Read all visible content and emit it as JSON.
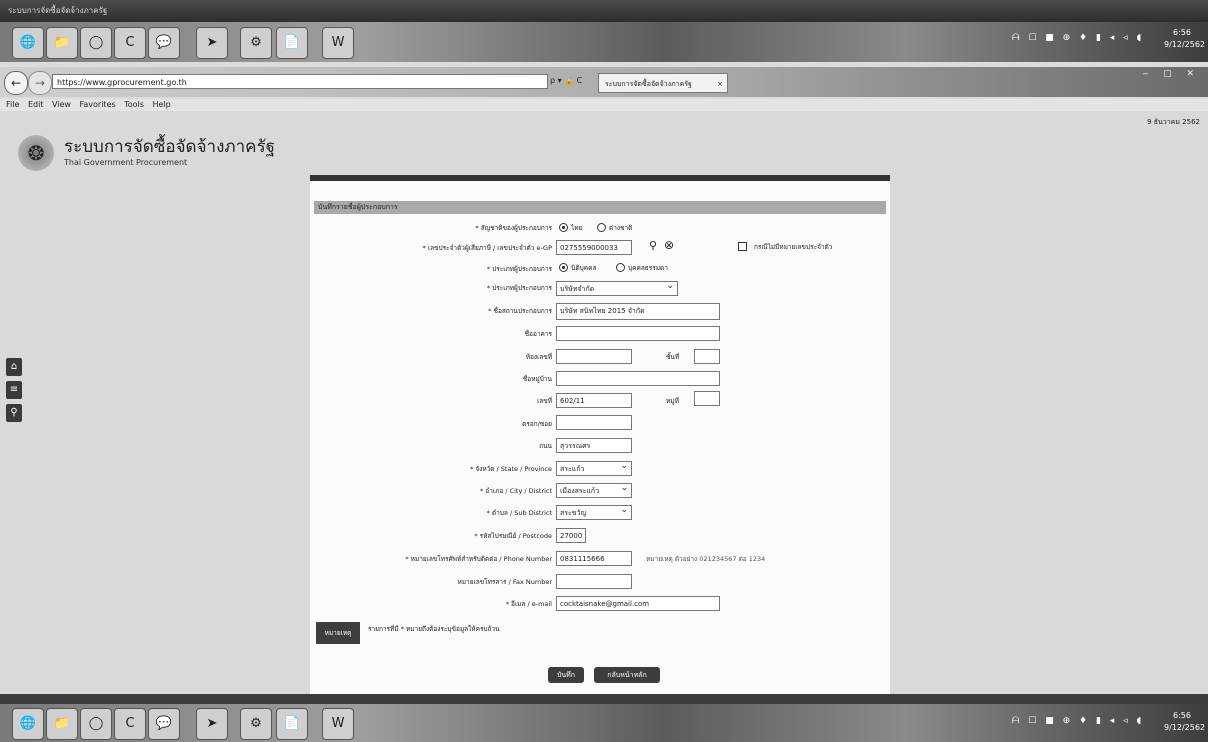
{
  "titlebar": {
    "text": "ระบบการจัดซื้อจัดจ้างภาครัฐ",
    "right_text": ""
  },
  "browser": {
    "url": "https://www.gprocurement.go.th",
    "tab_label": "ระบบการจัดซื้อจัดจ้างภาครัฐ",
    "tab_close": "×",
    "url_controls": "ρ ▾ 🔒 C",
    "back": "←",
    "forward": "→",
    "window_buttons": "‒ ▢ ✕"
  },
  "menu": {
    "items": [
      "File",
      "Edit",
      "View",
      "Favorites",
      "Tools",
      "Help"
    ]
  },
  "site": {
    "name": "ระบบการจัดซื้อจัดจ้างภาครัฐ",
    "subtitle": "Thai Government Procurement",
    "logo_glyph": "❂"
  },
  "user": {
    "date": "9 ธันวาคม 2562",
    "line2": "",
    "line3": ""
  },
  "sidebar": {
    "home_icon": "⌂",
    "menu_icon": "≡",
    "search_icon": "⚲"
  },
  "form": {
    "section_title": "บันทึกรายชื่อผู้ประกอบการ",
    "labels": {
      "nationality": "* สัญชาติของผู้ประกอบการ",
      "tax_id": "* เลขประจำตัวผู้เสียภาษี / เลขประจำตัว e-GP",
      "type": "* ประเภทผู้ประกอบการ",
      "category": "* ประเภทผู้ประกอบการ",
      "name": "* ชื่อสถานประกอบการ",
      "building": "ชื่ออาคาร",
      "room": "ห้องเลขที่",
      "village": "ชื่อหมู่บ้าน",
      "number": "เลขที่",
      "soi": "ตรอก/ซอย",
      "road": "ถนน",
      "province": "* จังหวัด / State / Province",
      "district": "* อำเภอ / City / District",
      "subdistrict": "* ตำบล / Sub District",
      "postcode": "* รหัสไปรษณีย์ / Postcode",
      "phone": "* หมายเลขโทรศัพท์สำหรับติดต่อ / Phone Number",
      "fax": "หมายเลขโทรสาร / Fax Number",
      "email": "* อีเมล / e-mail",
      "floor": "ชั้นที่",
      "moo": "หมู่ที่"
    },
    "radios": {
      "nat_thai": "ไทย",
      "nat_foreign": "ต่างชาติ",
      "type_person": "นิติบุคคล",
      "type_individual": "บุคคลธรรมดา"
    },
    "checkbox_label": "กรณีไม่มีหมายเลขประจำตัว",
    "values": {
      "tax_id": "0275559000033",
      "category": "บริษัทจำกัด",
      "name": "บริษัท สนิทไทย 2015 จำกัด",
      "building": "",
      "room": "",
      "floor": "",
      "village": "",
      "number": "602/11",
      "moo": "",
      "soi": "",
      "road": "สุวรรณศร",
      "province": "สระแก้ว",
      "district": "เมืองสระแก้ว",
      "subdistrict": "สระขวัญ",
      "postcode": "27000",
      "phone": "0831115666",
      "fax": "",
      "email": "cocktaisnake@gmail.com"
    },
    "phone_hint": "หมายเหตุ ตัวอย่าง 021234567 ต่อ 1234",
    "search_icon": "⚲",
    "clear_icon": "⊗",
    "note_label": "หมายเหตุ",
    "note_text": "รายการที่มี * หมายถึงต้องระบุข้อมูลให้ครบถ้วน",
    "btn_save": "บันทึก",
    "btn_back": "กลับหน้าหลัก"
  },
  "taskbar": {
    "icons": [
      "🌐",
      "📁",
      "◯",
      "C",
      "💬",
      "➤",
      "⚙",
      "📄",
      "W"
    ],
    "tray": "ᗩ ☐ ■ ⊕ ♦ ▮ ◂ ◃ ◖",
    "time": "6:56",
    "date": "9/12/2562"
  },
  "statusbar": {
    "text": "",
    "right": ""
  }
}
